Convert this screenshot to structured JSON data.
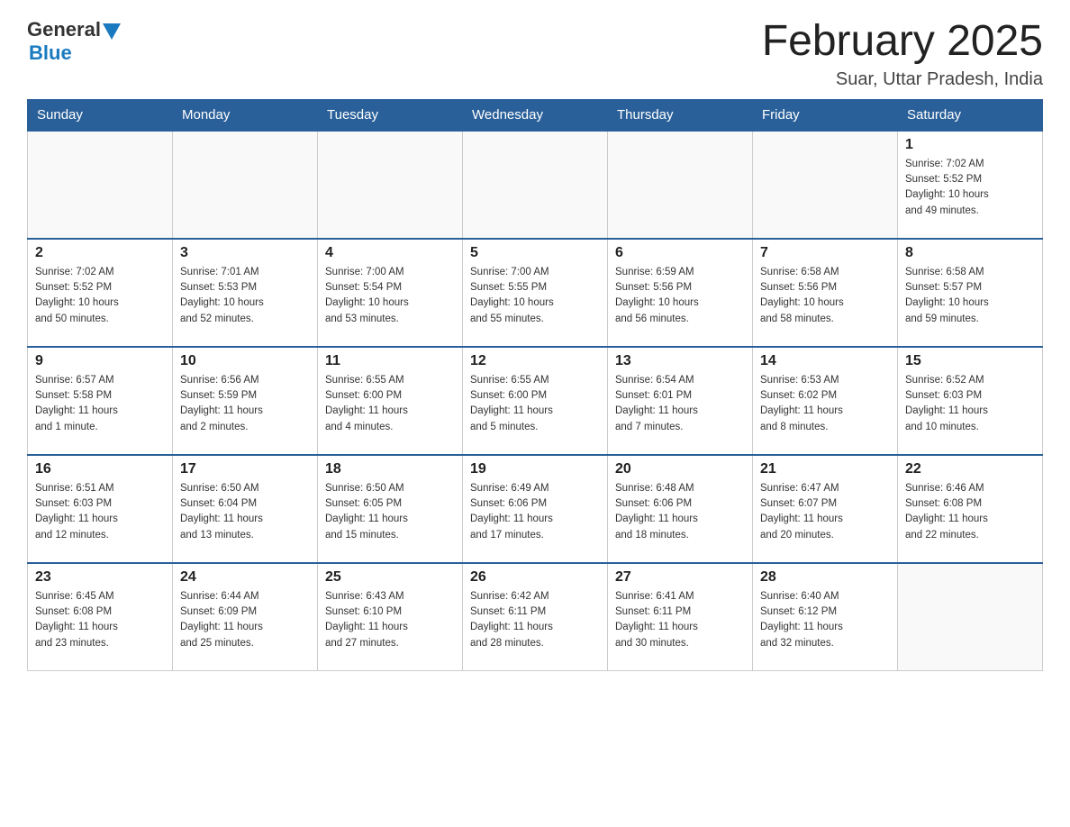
{
  "header": {
    "logo": {
      "general": "General",
      "blue": "Blue",
      "alt": "GeneralBlue Logo"
    },
    "title": "February 2025",
    "location": "Suar, Uttar Pradesh, India"
  },
  "calendar": {
    "days_of_week": [
      "Sunday",
      "Monday",
      "Tuesday",
      "Wednesday",
      "Thursday",
      "Friday",
      "Saturday"
    ],
    "weeks": [
      [
        {
          "day": "",
          "info": ""
        },
        {
          "day": "",
          "info": ""
        },
        {
          "day": "",
          "info": ""
        },
        {
          "day": "",
          "info": ""
        },
        {
          "day": "",
          "info": ""
        },
        {
          "day": "",
          "info": ""
        },
        {
          "day": "1",
          "info": "Sunrise: 7:02 AM\nSunset: 5:52 PM\nDaylight: 10 hours\nand 49 minutes."
        }
      ],
      [
        {
          "day": "2",
          "info": "Sunrise: 7:02 AM\nSunset: 5:52 PM\nDaylight: 10 hours\nand 50 minutes."
        },
        {
          "day": "3",
          "info": "Sunrise: 7:01 AM\nSunset: 5:53 PM\nDaylight: 10 hours\nand 52 minutes."
        },
        {
          "day": "4",
          "info": "Sunrise: 7:00 AM\nSunset: 5:54 PM\nDaylight: 10 hours\nand 53 minutes."
        },
        {
          "day": "5",
          "info": "Sunrise: 7:00 AM\nSunset: 5:55 PM\nDaylight: 10 hours\nand 55 minutes."
        },
        {
          "day": "6",
          "info": "Sunrise: 6:59 AM\nSunset: 5:56 PM\nDaylight: 10 hours\nand 56 minutes."
        },
        {
          "day": "7",
          "info": "Sunrise: 6:58 AM\nSunset: 5:56 PM\nDaylight: 10 hours\nand 58 minutes."
        },
        {
          "day": "8",
          "info": "Sunrise: 6:58 AM\nSunset: 5:57 PM\nDaylight: 10 hours\nand 59 minutes."
        }
      ],
      [
        {
          "day": "9",
          "info": "Sunrise: 6:57 AM\nSunset: 5:58 PM\nDaylight: 11 hours\nand 1 minute."
        },
        {
          "day": "10",
          "info": "Sunrise: 6:56 AM\nSunset: 5:59 PM\nDaylight: 11 hours\nand 2 minutes."
        },
        {
          "day": "11",
          "info": "Sunrise: 6:55 AM\nSunset: 6:00 PM\nDaylight: 11 hours\nand 4 minutes."
        },
        {
          "day": "12",
          "info": "Sunrise: 6:55 AM\nSunset: 6:00 PM\nDaylight: 11 hours\nand 5 minutes."
        },
        {
          "day": "13",
          "info": "Sunrise: 6:54 AM\nSunset: 6:01 PM\nDaylight: 11 hours\nand 7 minutes."
        },
        {
          "day": "14",
          "info": "Sunrise: 6:53 AM\nSunset: 6:02 PM\nDaylight: 11 hours\nand 8 minutes."
        },
        {
          "day": "15",
          "info": "Sunrise: 6:52 AM\nSunset: 6:03 PM\nDaylight: 11 hours\nand 10 minutes."
        }
      ],
      [
        {
          "day": "16",
          "info": "Sunrise: 6:51 AM\nSunset: 6:03 PM\nDaylight: 11 hours\nand 12 minutes."
        },
        {
          "day": "17",
          "info": "Sunrise: 6:50 AM\nSunset: 6:04 PM\nDaylight: 11 hours\nand 13 minutes."
        },
        {
          "day": "18",
          "info": "Sunrise: 6:50 AM\nSunset: 6:05 PM\nDaylight: 11 hours\nand 15 minutes."
        },
        {
          "day": "19",
          "info": "Sunrise: 6:49 AM\nSunset: 6:06 PM\nDaylight: 11 hours\nand 17 minutes."
        },
        {
          "day": "20",
          "info": "Sunrise: 6:48 AM\nSunset: 6:06 PM\nDaylight: 11 hours\nand 18 minutes."
        },
        {
          "day": "21",
          "info": "Sunrise: 6:47 AM\nSunset: 6:07 PM\nDaylight: 11 hours\nand 20 minutes."
        },
        {
          "day": "22",
          "info": "Sunrise: 6:46 AM\nSunset: 6:08 PM\nDaylight: 11 hours\nand 22 minutes."
        }
      ],
      [
        {
          "day": "23",
          "info": "Sunrise: 6:45 AM\nSunset: 6:08 PM\nDaylight: 11 hours\nand 23 minutes."
        },
        {
          "day": "24",
          "info": "Sunrise: 6:44 AM\nSunset: 6:09 PM\nDaylight: 11 hours\nand 25 minutes."
        },
        {
          "day": "25",
          "info": "Sunrise: 6:43 AM\nSunset: 6:10 PM\nDaylight: 11 hours\nand 27 minutes."
        },
        {
          "day": "26",
          "info": "Sunrise: 6:42 AM\nSunset: 6:11 PM\nDaylight: 11 hours\nand 28 minutes."
        },
        {
          "day": "27",
          "info": "Sunrise: 6:41 AM\nSunset: 6:11 PM\nDaylight: 11 hours\nand 30 minutes."
        },
        {
          "day": "28",
          "info": "Sunrise: 6:40 AM\nSunset: 6:12 PM\nDaylight: 11 hours\nand 32 minutes."
        },
        {
          "day": "",
          "info": ""
        }
      ]
    ]
  }
}
